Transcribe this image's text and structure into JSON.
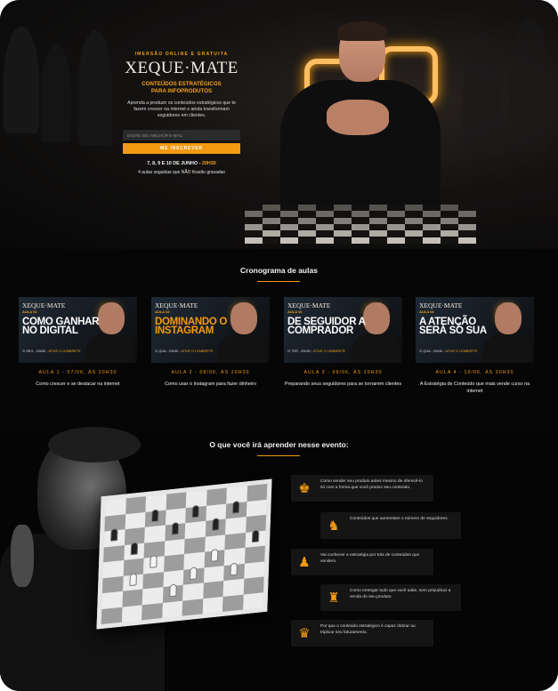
{
  "hero": {
    "eyebrow": "IMERSÃO ONLINE E GRATUITA",
    "brand": "XEQUE·MATE",
    "subtitle_line1": "CONTEÚDOS ESTRATÉGICOS",
    "subtitle_line2": "PARA INFOPRODUTOS",
    "description": "Aprenda a produzir os conteúdos estratégicos que te fazem crescer na internet e ainda transformam seguidores em clientes.",
    "email_placeholder": "DIGITE SEU MELHOR E-MAIL",
    "cta_label": "ME INSCREVER",
    "dates_main": "7, 8, 9 E 10 DE JUNHO - ",
    "dates_time": "20H30",
    "note": "4 aulas seguidas que NÃO ficarão gravadas"
  },
  "schedule": {
    "title": "Cronograma de aulas",
    "cards": [
      {
        "brand": "XEQUE·MATE",
        "aula": "AULA 01",
        "headline": "COMO GANHAR NO DIGITAL",
        "orange": false,
        "meta_day": "SEG - 20h30 - ",
        "meta_cta": "ATIVE O LEMBRETE",
        "label": "AULA 1 - 07/06, ÀS 20H30",
        "desc": "Como crescer e se destacar na internet"
      },
      {
        "brand": "XEQUE·MATE",
        "aula": "AULA 02",
        "headline": "DOMINANDO O INSTAGRAM",
        "orange": true,
        "meta_day": "QUA - 20h30 - ",
        "meta_cta": "ATIVE O LEMBRETE",
        "label": "AULA 2 - 08/06, ÀS 20H30",
        "desc": "Como usar o Instagram para fazer dinheiro"
      },
      {
        "brand": "XEQUE·MATE",
        "aula": "AULA 03",
        "headline": "DE SEGUIDOR A COMPRADOR",
        "orange": false,
        "meta_day": "TER - 20h30 - ",
        "meta_cta": "ATIVE O LEMBRETE",
        "label": "AULA 3 - 09/06, ÀS 20H30",
        "desc": "Preparando seus seguidores para se tornarem clientes"
      },
      {
        "brand": "XEQUE·MATE",
        "aula": "AULA 04",
        "headline": "A ATENÇÃO SERÁ SÓ SUA",
        "orange": false,
        "meta_day": "QUA - 20h30 - ",
        "meta_cta": "ATIVE O LEMBRETE",
        "label": "AULA 4 - 10/06, ÀS 20H30",
        "desc": "A Estratégia de Conteúdo que mais vende curso na internet"
      }
    ]
  },
  "learn": {
    "title": "O que você irá aprender nesse evento:",
    "items": [
      {
        "icon": "chess-king-icon",
        "glyph": "♚",
        "text": "Como vender seu produto antes mesmo de oferecê-lo só com a forma que você produz seu conteúdo."
      },
      {
        "icon": "chess-knight-icon",
        "glyph": "♞",
        "text": "Conteúdos que aumentam o número de seguidores."
      },
      {
        "icon": "chess-pawn-icon",
        "glyph": "♟",
        "text": "Vai conhecer a estratégia por trás de conteúdos que vendem."
      },
      {
        "icon": "chess-rook-icon",
        "glyph": "♜",
        "text": "Como entregar tudo que você sabe, sem prejudicar a venda do seu produto."
      },
      {
        "icon": "crown-icon",
        "glyph": "♛",
        "text": "Por que o conteúdo estratégico é capaz dobrar ou triplicar seu faturamento."
      }
    ]
  },
  "colors": {
    "accent": "#f39a12",
    "background": "#060606"
  }
}
